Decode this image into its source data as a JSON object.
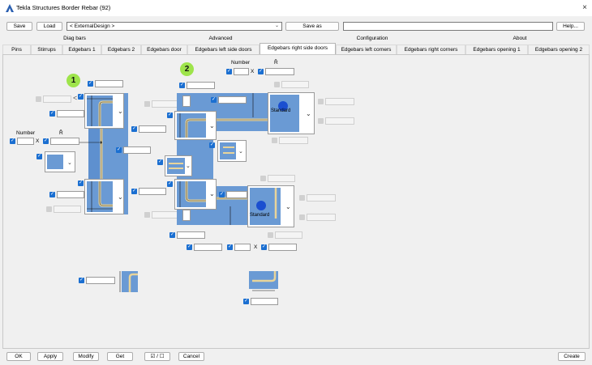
{
  "window": {
    "title": "Tekla Structures  Border Rebar (92)",
    "close_glyph": "×"
  },
  "toolbar": {
    "save_label": "Save",
    "load_label": "Load",
    "design_value": "< ExternalDesign >",
    "saveas_label": "Save as",
    "saveas_value": "",
    "help_label": "Help..."
  },
  "group_headers": [
    "Diag bars",
    "Advanced",
    "Configuration",
    "About"
  ],
  "tabs": [
    "Pins",
    "Stirrups",
    "Edgebars 1",
    "Edgebars 2",
    "Edgebars door",
    "Edgebars left side doors",
    "Edgebars right side doors",
    "Edgebars left corners",
    "Edgebars right corners",
    "Edgebars opening 1",
    "Edgebars opening 2"
  ],
  "selected_tab": "Edgebars right side doors",
  "content": {
    "badge1": "1",
    "badge2": "2",
    "number_label": "Number",
    "r_label": "R̂",
    "x_label": "X",
    "standard_label": "Standard"
  },
  "bottom": {
    "ok_label": "OK",
    "apply_label": "Apply",
    "modify_label": "Modify",
    "get_label": "Get",
    "toggle_label": "☑ / ☐",
    "cancel_label": "Cancel",
    "create_label": "Create"
  }
}
